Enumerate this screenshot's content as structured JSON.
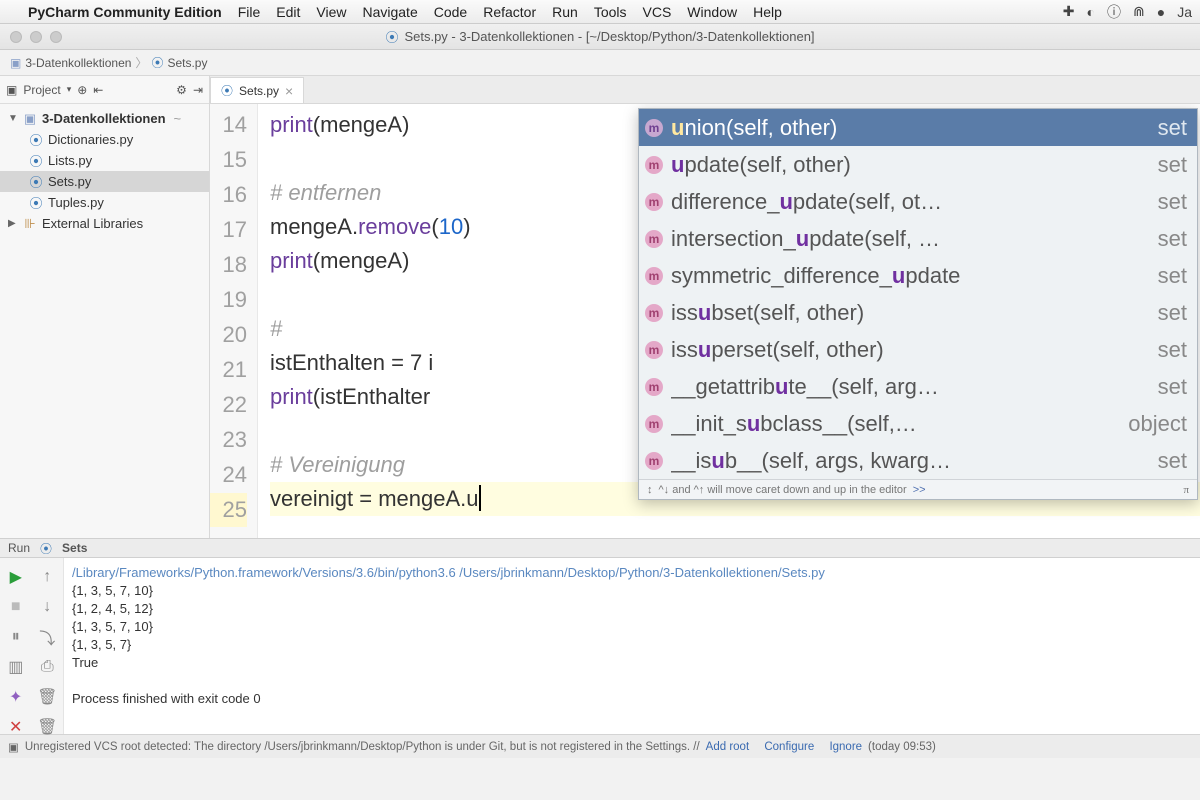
{
  "mac_menu": {
    "appname": "PyCharm Community Edition",
    "items": [
      "File",
      "Edit",
      "View",
      "Navigate",
      "Code",
      "Refactor",
      "Run",
      "Tools",
      "VCS",
      "Window",
      "Help"
    ],
    "clock_partial": "Ja"
  },
  "window_title": "Sets.py - 3-Datenkollektionen - [~/Desktop/Python/3-Datenkollektionen]",
  "breadcrumb": {
    "folder": "3-Datenkollektionen",
    "file": "Sets.py"
  },
  "sidebar": {
    "header": "Project",
    "root": "3-Datenkollektionen",
    "files": [
      "Dictionaries.py",
      "Lists.py",
      "Sets.py",
      "Tuples.py"
    ],
    "selected": "Sets.py",
    "external": "External Libraries"
  },
  "tab": {
    "label": "Sets.py"
  },
  "gutter_lines": [
    "14",
    "15",
    "16",
    "17",
    "18",
    "19",
    "20",
    "21",
    "22",
    "23",
    "24",
    "25"
  ],
  "code": {
    "l14": "print(mengeA)",
    "l16_comment": "# entfernen",
    "l17_a": "mengeA.",
    "l17_fn": "remove",
    "l17_b": "(",
    "l17_num": "10",
    "l17_c": ")",
    "l18": "print(mengeA)",
    "l20_comment": "#",
    "l21": "istEnthalten = 7 i",
    "l22": "print(istEnthalter",
    "l24_comment": "# Vereinigung",
    "l25_a": "vereinigt = mengeA.",
    "l25_u": "u"
  },
  "autocomplete": {
    "items": [
      {
        "sig_pre": "",
        "hl": "u",
        "sig_post": "nion(self, other)",
        "ret": "set",
        "sel": true
      },
      {
        "sig_pre": "",
        "hl": "u",
        "sig_post": "pdate(self, other)",
        "ret": "set"
      },
      {
        "sig_pre": "difference_",
        "hl": "u",
        "sig_post": "pdate(self, ot…",
        "ret": "set"
      },
      {
        "sig_pre": "intersection_",
        "hl": "u",
        "sig_post": "pdate(self, …",
        "ret": "set"
      },
      {
        "sig_pre": "symmetric_difference_",
        "hl": "u",
        "sig_post": "pdate",
        "ret": "set"
      },
      {
        "sig_pre": "iss",
        "hl": "u",
        "sig_post": "bset(self, other)",
        "ret": "set"
      },
      {
        "sig_pre": "iss",
        "hl": "u",
        "sig_post": "perset(self, other)",
        "ret": "set"
      },
      {
        "sig_pre": "__getattrib",
        "hl": "u",
        "sig_post": "te__(self, arg…",
        "ret": "set"
      },
      {
        "sig_pre": "__init_s",
        "hl": "u",
        "sig_post": "bclass__(self,…",
        "ret": "object"
      },
      {
        "sig_pre": "__is",
        "hl": "u",
        "sig_post": "b__(self, args, kwarg…",
        "ret": "set"
      }
    ],
    "hint_pre": "^↓ and ^↑ will move caret down and up in the editor ",
    "hint_link": ">>"
  },
  "run": {
    "label": "Run",
    "config": "Sets",
    "lines": [
      "/Library/Frameworks/Python.framework/Versions/3.6/bin/python3.6 /Users/jbrinkmann/Desktop/Python/3-Datenkollektionen/Sets.py",
      "{1, 3, 5, 7, 10}",
      "{1, 2, 4, 5, 12}",
      "{1, 3, 5, 7, 10}",
      "{1, 3, 5, 7}",
      "True",
      "",
      "Process finished with exit code 0"
    ]
  },
  "statusbar": {
    "msg": "Unregistered VCS root detected: The directory /Users/jbrinkmann/Desktop/Python is under Git, but is not registered in the Settings. // ",
    "links": [
      "Add root",
      "Configure",
      "Ignore"
    ],
    "time": "(today 09:53)"
  }
}
